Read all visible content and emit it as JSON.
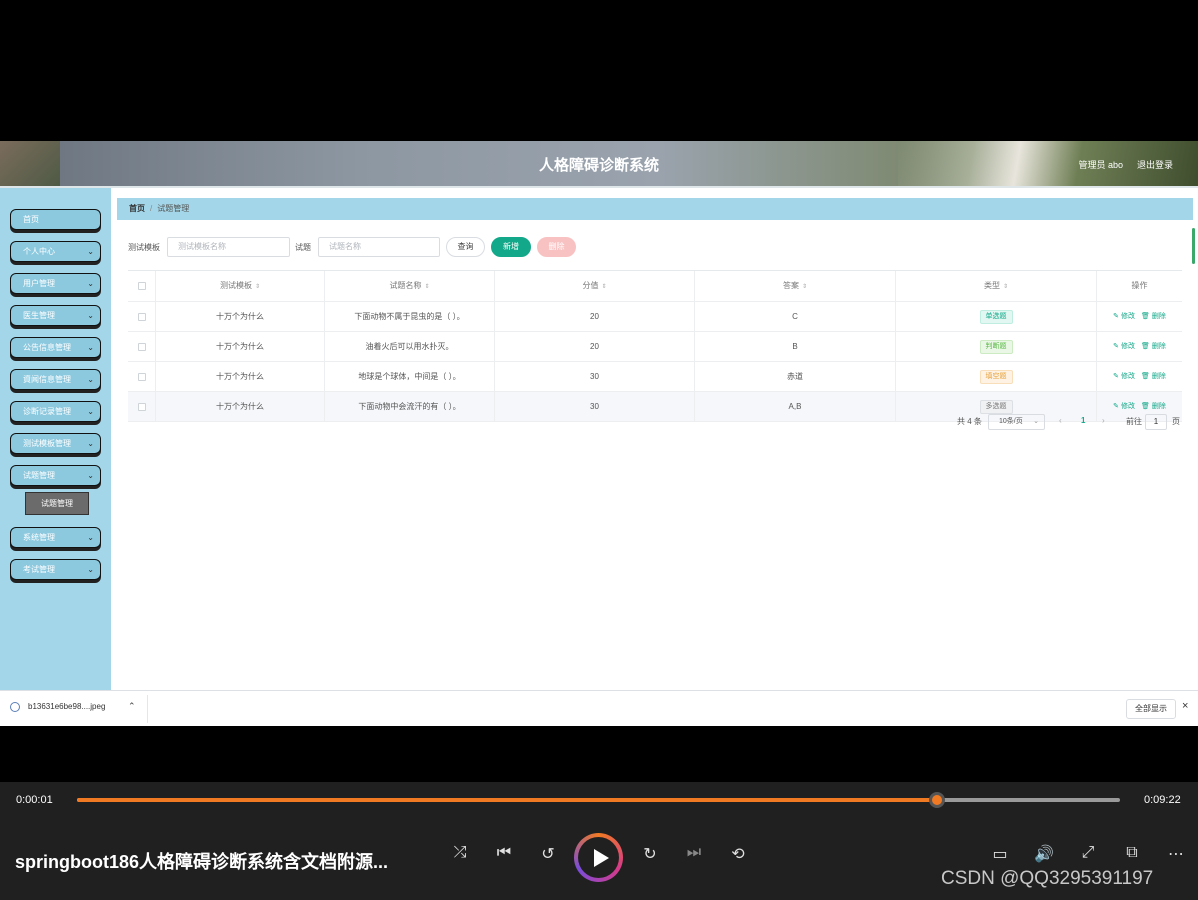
{
  "app": {
    "title": "人格障碍诊断系统",
    "user": "管理员 abo",
    "logout": "退出登录"
  },
  "sidebar": {
    "items": [
      {
        "label": "首页",
        "chevron": false
      },
      {
        "label": "个人中心",
        "chevron": true
      },
      {
        "label": "用户管理",
        "chevron": true
      },
      {
        "label": "医生管理",
        "chevron": true
      },
      {
        "label": "公告信息管理",
        "chevron": true
      },
      {
        "label": "資闻信息管理",
        "chevron": true
      },
      {
        "label": "诊断记录管理",
        "chevron": true
      },
      {
        "label": "测试模板管理",
        "chevron": true
      },
      {
        "label": "试题管理",
        "chevron": true
      },
      {
        "label": "系统管理",
        "chevron": true
      },
      {
        "label": "考试管理",
        "chevron": true
      }
    ],
    "submenu": "试题管理"
  },
  "breadcrumb": {
    "home": "首页",
    "separator": "/",
    "current": "试题管理"
  },
  "filters": {
    "template_label": "测试模板",
    "template_placeholder": "测试模板名称",
    "question_label": "试题",
    "question_placeholder": "试题名称",
    "query_button": "查询",
    "add_button": "新增",
    "delete_button": "删除"
  },
  "table": {
    "columns": [
      "测试模板",
      "试题名称",
      "分值",
      "答案",
      "类型",
      "操作"
    ],
    "rows": [
      {
        "template": "十万个为什么",
        "name": "下面动物不属于昆虫的是（ ）。",
        "score": "20",
        "answer": "C",
        "type": "单选题"
      },
      {
        "template": "十万个为什么",
        "name": "油着火后可以用水扑灭。",
        "score": "20",
        "answer": "B",
        "type": "判断题"
      },
      {
        "template": "十万个为什么",
        "name": "地球是个球体，中间是（ ）。",
        "score": "30",
        "answer": "赤道",
        "type": "填空题"
      },
      {
        "template": "十万个为什么",
        "name": "下面动物中会流汗的有（ ）。",
        "score": "30",
        "answer": "A,B",
        "type": "多选题"
      }
    ],
    "edit_label": "修改",
    "delete_label": "删除"
  },
  "pagination": {
    "total": "共 4 条",
    "page_size": "10条/页",
    "prev": "‹",
    "current_page": "1",
    "next": "›",
    "goto_label": "前往",
    "goto_value": "1",
    "page_suffix": "页"
  },
  "download_bar": {
    "file": "b13631e6be98....jpeg",
    "show_all": "全部显示",
    "close": "×"
  },
  "player": {
    "elapsed": "0:00:01",
    "duration": "0:09:22",
    "progress": 0.825,
    "video_title": "springboot186人格障碍诊断系统含文档附源...",
    "watermark": "CSDN @QQ3295391197"
  },
  "colors": {
    "sidebar": "#a3d6e8",
    "accent": "#12a889",
    "delete": "#f9c2c2",
    "progress": "#f07a24"
  }
}
